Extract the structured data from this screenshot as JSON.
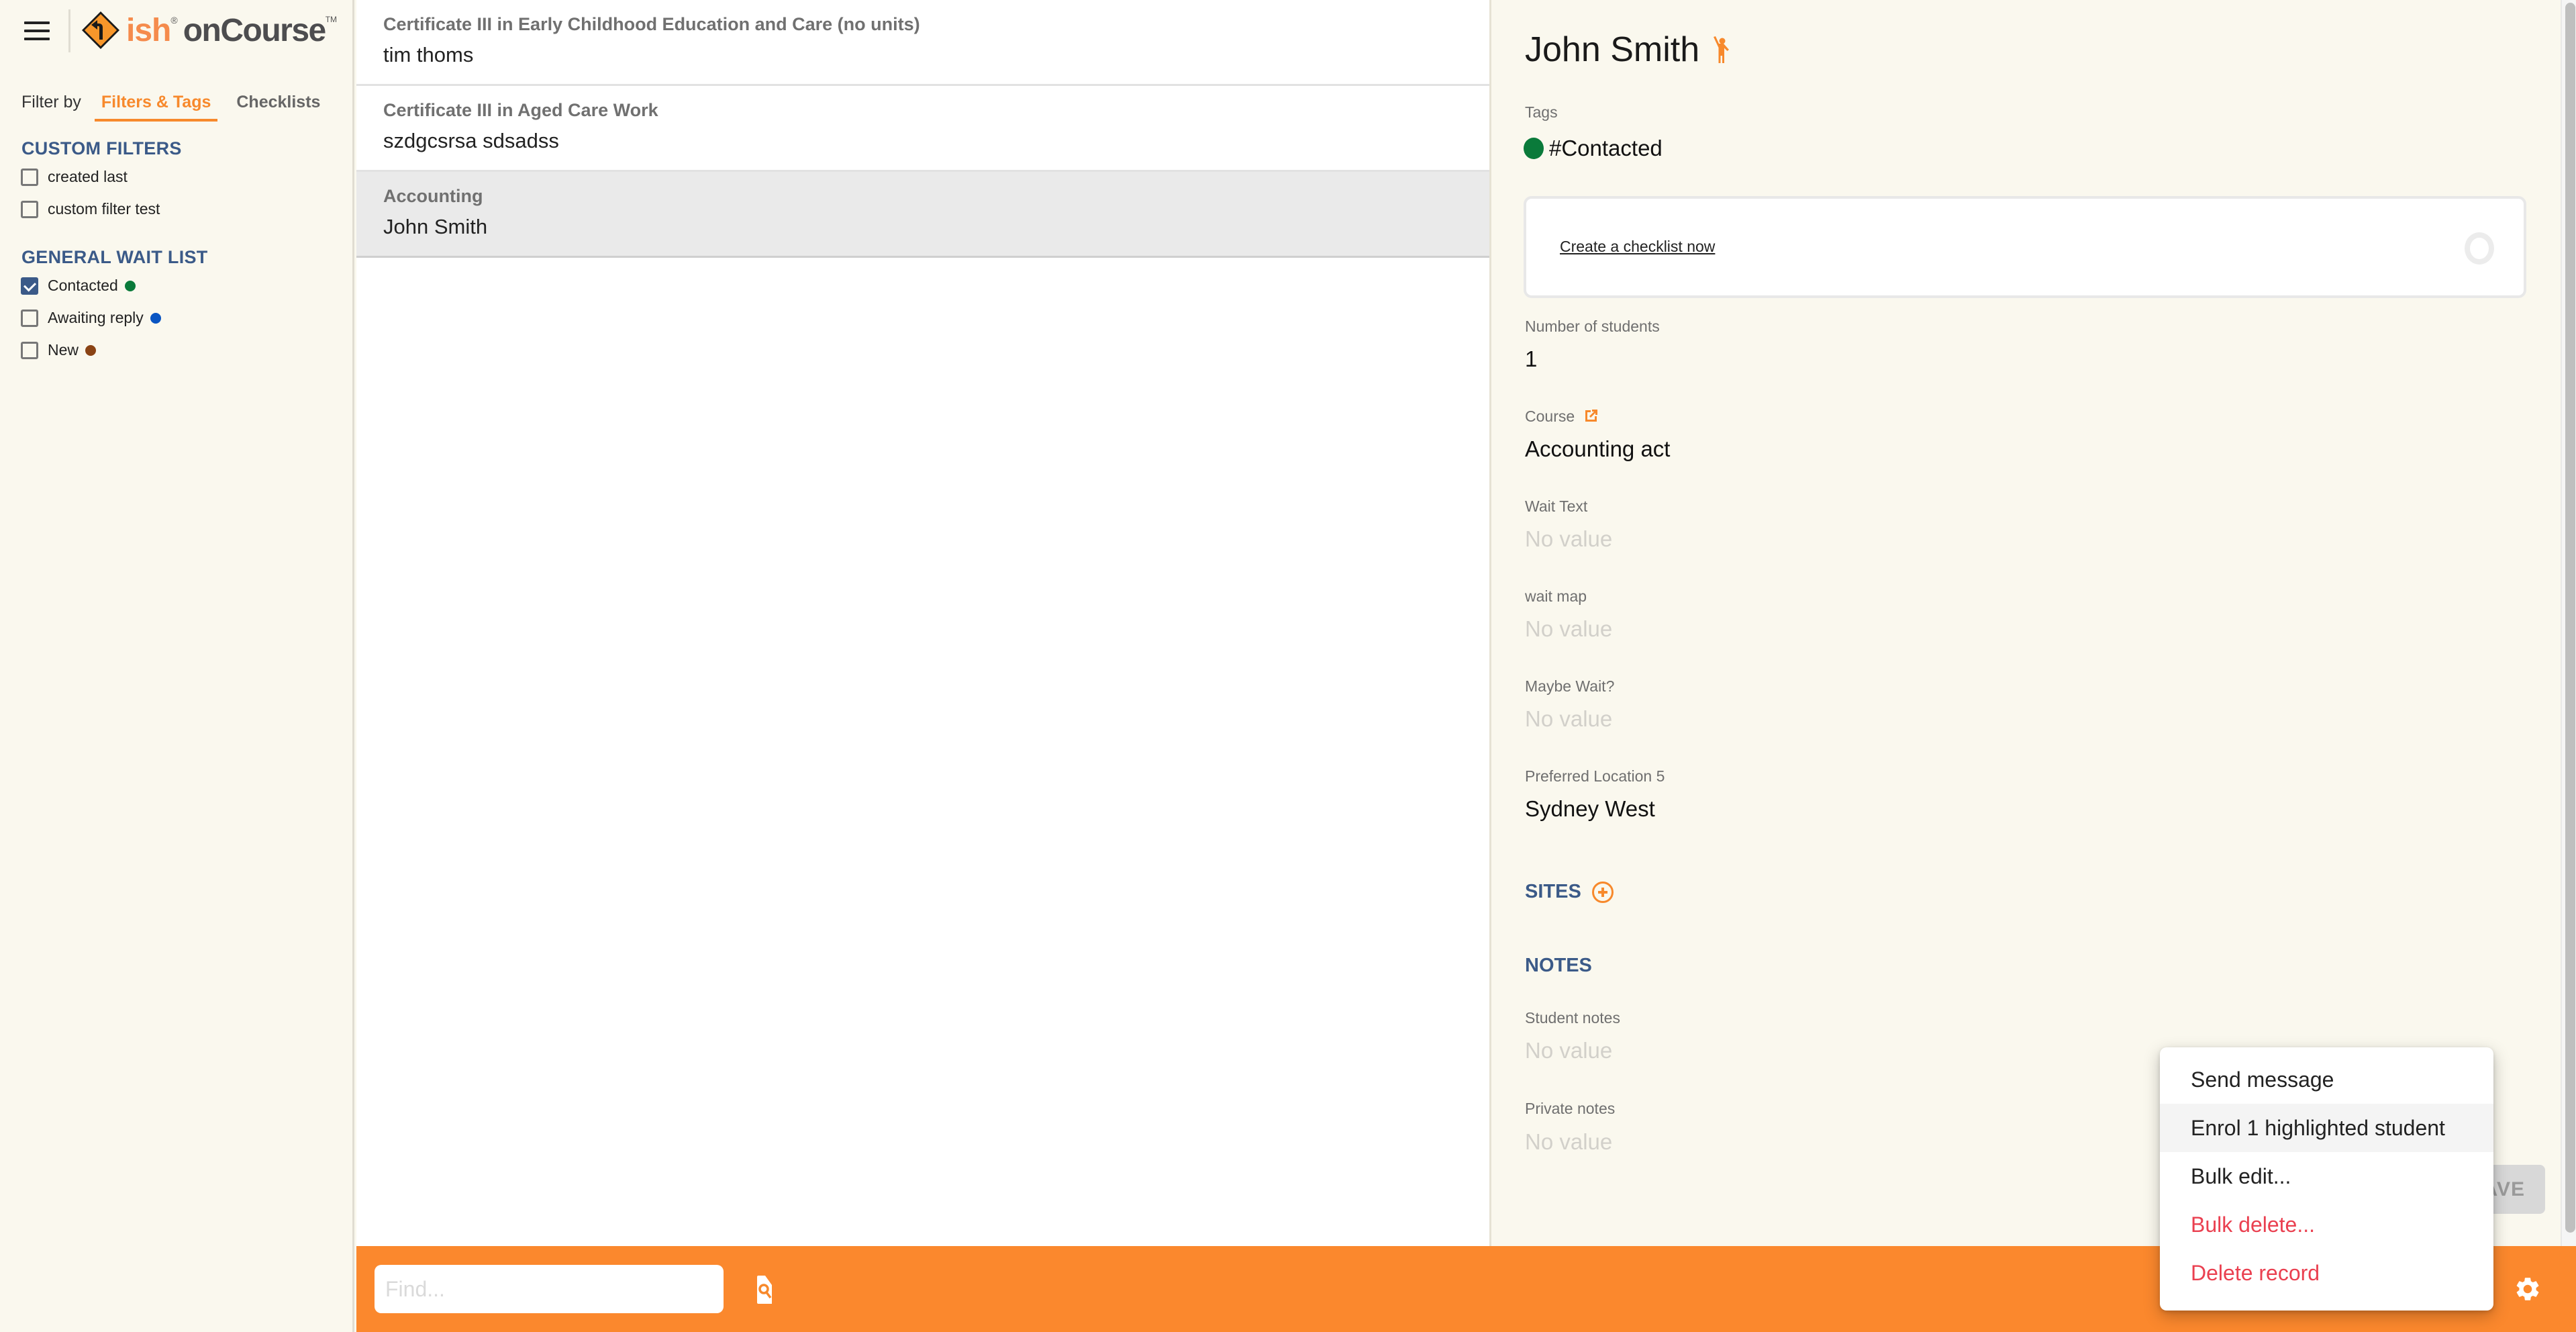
{
  "app": {
    "logo_ish": "ish",
    "logo_reg": "®",
    "logo_oncourse": "onCourse",
    "logo_tm": "TM"
  },
  "sidebar": {
    "filter_by_label": "Filter by",
    "tabs": [
      {
        "label": "Filters & Tags",
        "active": true
      },
      {
        "label": "Checklists",
        "active": false
      }
    ],
    "custom_filters": {
      "heading": "CUSTOM FILTERS",
      "items": [
        {
          "label": "created last",
          "checked": false
        },
        {
          "label": "custom filter test",
          "checked": false
        }
      ]
    },
    "general_wait_list": {
      "heading": "GENERAL WAIT LIST",
      "items": [
        {
          "label": "Contacted",
          "checked": true,
          "color": "#0a7a3a"
        },
        {
          "label": "Awaiting reply",
          "checked": false,
          "color": "#0a55c2"
        },
        {
          "label": "New",
          "checked": false,
          "color": "#8a4314"
        }
      ]
    }
  },
  "list": {
    "rows": [
      {
        "title": "Certificate III in Early Childhood Education and Care (no units)",
        "subtitle": "tim thoms",
        "selected": false
      },
      {
        "title": "Certificate III in Aged Care Work",
        "subtitle": "szdgcsrsa sdsadss",
        "selected": false
      },
      {
        "title": "Accounting",
        "subtitle": "John Smith",
        "selected": true
      }
    ]
  },
  "detail": {
    "title": "John Smith",
    "title_icon": "person-waving-icon",
    "tags_label": "Tags",
    "tag": {
      "label": "#Contacted",
      "color": "#0a7a3a"
    },
    "checklist_link": "Create a checklist now",
    "fields": [
      {
        "label": "Number of students",
        "value": "1",
        "empty": false
      },
      {
        "label": "Course",
        "value": "Accounting act",
        "empty": false,
        "link_icon": "external-link-icon"
      },
      {
        "label": "Wait Text",
        "value": "No value",
        "empty": true
      },
      {
        "label": "wait map",
        "value": "No value",
        "empty": true
      },
      {
        "label": "Maybe Wait?",
        "value": "No value",
        "empty": true
      },
      {
        "label": "Preferred Location 5",
        "value": "Sydney West",
        "empty": false
      }
    ],
    "sites_heading": "SITES",
    "notes_heading": "NOTES",
    "notes": [
      {
        "label": "Student notes",
        "value": "No value"
      },
      {
        "label": "Private notes",
        "value": "No value"
      }
    ],
    "save_label": "SAVE"
  },
  "bottom_bar": {
    "find_placeholder": "Find...",
    "find_value": "",
    "color": "#fb882d"
  },
  "menu": {
    "items": [
      {
        "label": "Send message",
        "danger": false,
        "hover": false
      },
      {
        "label": "Enrol 1 highlighted student",
        "danger": false,
        "hover": true
      },
      {
        "label": "Bulk edit...",
        "danger": false,
        "hover": false
      },
      {
        "label": "Bulk delete...",
        "danger": true,
        "hover": false
      },
      {
        "label": "Delete record",
        "danger": true,
        "hover": false
      }
    ]
  }
}
